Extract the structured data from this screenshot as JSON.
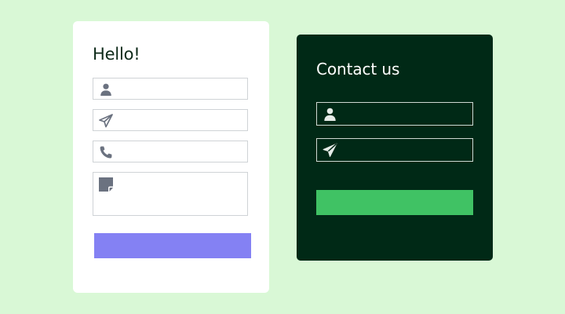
{
  "colors": {
    "background": "#d9f8d6",
    "light_card": "#ffffff",
    "dark_card": "#002916",
    "purple_button": "#8481f3",
    "green_button": "#40c264",
    "light_icon": "#6b7280",
    "dark_icon": "#e6ece8"
  },
  "left_form": {
    "title": "Hello!",
    "fields": [
      {
        "icon": "user-icon",
        "value": ""
      },
      {
        "icon": "paper-plane-icon",
        "value": ""
      },
      {
        "icon": "phone-icon",
        "value": ""
      },
      {
        "icon": "note-icon",
        "value": ""
      }
    ],
    "submit_label": ""
  },
  "right_form": {
    "title": "Contact us",
    "fields": [
      {
        "icon": "user-icon",
        "value": ""
      },
      {
        "icon": "paper-plane-icon",
        "value": ""
      }
    ],
    "submit_label": ""
  }
}
